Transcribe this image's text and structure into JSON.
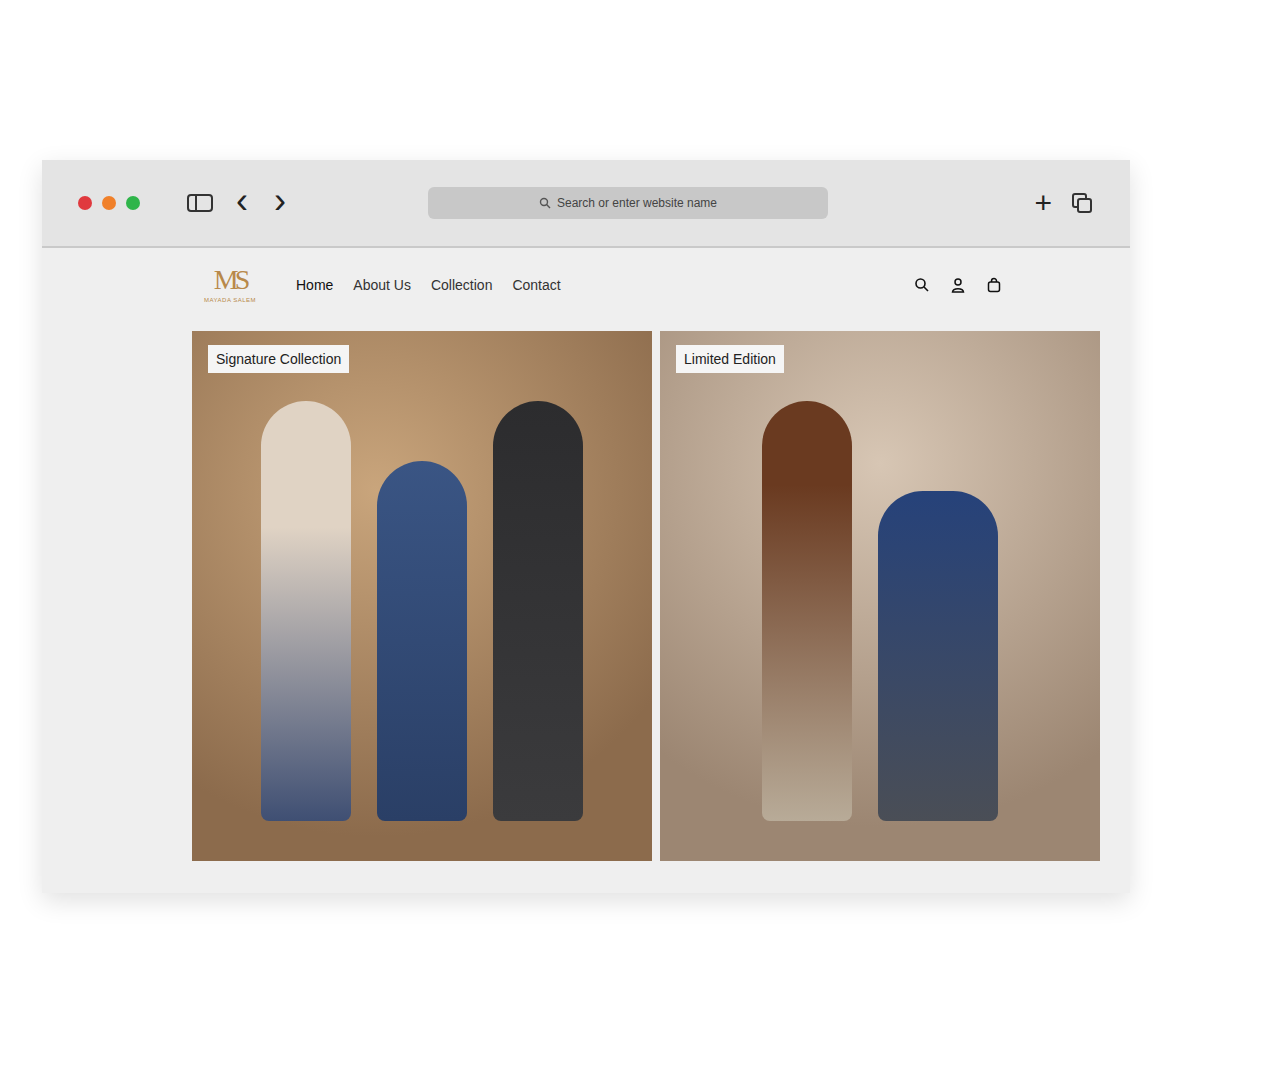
{
  "browser": {
    "traffic_lights": [
      {
        "name": "close",
        "color": "#e0393e"
      },
      {
        "name": "minimize",
        "color": "#f0802a"
      },
      {
        "name": "maximize",
        "color": "#2fb54a"
      }
    ],
    "back_icon": "‹",
    "forward_icon": "›",
    "new_tab_icon": "+",
    "address_bar": {
      "placeholder": "Search or enter website name"
    }
  },
  "site": {
    "logo": {
      "monogram": "MS",
      "name": "MAYADA SALEM"
    },
    "nav": [
      {
        "label": "Home",
        "selected": true
      },
      {
        "label": "About Us",
        "selected": false
      },
      {
        "label": "Collection",
        "selected": false
      },
      {
        "label": "Contact",
        "selected": false
      }
    ],
    "cards": [
      {
        "badge": "Signature Collection",
        "kind": "studio"
      },
      {
        "badge": "Limited Edition",
        "kind": "arch"
      }
    ]
  }
}
